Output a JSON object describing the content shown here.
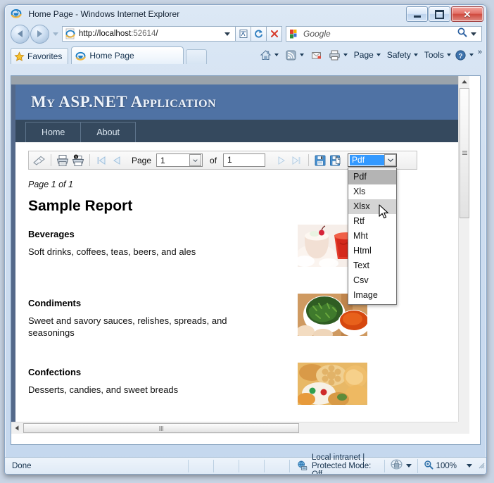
{
  "window": {
    "title": "Home Page - Windows Internet Explorer",
    "icon": "internet-explorer-icon",
    "minimize_label": "Minimize",
    "maximize_label": "Maximize",
    "close_label": "Close"
  },
  "navigation": {
    "back_label": "Back",
    "forward_label": "Forward",
    "recent_pages_label": "Recent Pages"
  },
  "address": {
    "url_scheme": "http://",
    "url_host": "localhost",
    "url_port": ":52614",
    "url_path": "/",
    "full_url": "http://localhost:52614/",
    "compat_view_label": "Compatibility View",
    "refresh_label": "Refresh",
    "stop_label": "Stop"
  },
  "search": {
    "placeholder": "Google",
    "provider": "Google",
    "go_label": "Search"
  },
  "favorites": {
    "label": "Favorites"
  },
  "tabs": [
    {
      "label": "Home Page",
      "icon": "internet-explorer-icon",
      "active": true
    }
  ],
  "newtab": {
    "label": "New Tab"
  },
  "command_bar": {
    "items": [
      {
        "label": "",
        "icon": "home-icon",
        "has_dropdown": true
      },
      {
        "label": "",
        "icon": "feeds-icon",
        "has_dropdown": true
      },
      {
        "label": "",
        "icon": "read-mail-icon",
        "has_dropdown": false
      },
      {
        "label": "",
        "icon": "print-icon",
        "has_dropdown": true
      },
      {
        "label": "Page",
        "icon": "",
        "has_dropdown": true
      },
      {
        "label": "Safety",
        "icon": "",
        "has_dropdown": true
      },
      {
        "label": "Tools",
        "icon": "",
        "has_dropdown": true
      },
      {
        "label": "",
        "icon": "help-icon",
        "has_dropdown": true
      }
    ],
    "overflow_label": "»"
  },
  "aspnet": {
    "site_title": "My ASP.NET Application",
    "nav": [
      {
        "label": "Home"
      },
      {
        "label": "About"
      }
    ]
  },
  "report_toolbar": {
    "document_map_label": "Document Map",
    "print_label": "Print",
    "print_layout_label": "Print Layout",
    "first_page_label": "First Page",
    "prev_page_label": "Previous Page",
    "page_label": "Page",
    "page_value": "1",
    "of_label": "of",
    "total_pages_value": "1",
    "next_page_label": "Next Page",
    "last_page_label": "Last Page",
    "save_label": "Save",
    "save_as_label": "Save As",
    "export_selected": "Pdf",
    "export_options": [
      {
        "label": "Pdf",
        "state": "selected"
      },
      {
        "label": "Xls",
        "state": "normal"
      },
      {
        "label": "Xlsx",
        "state": "hover"
      },
      {
        "label": "Rtf",
        "state": "normal"
      },
      {
        "label": "Mht",
        "state": "normal"
      },
      {
        "label": "Html",
        "state": "normal"
      },
      {
        "label": "Text",
        "state": "normal"
      },
      {
        "label": "Csv",
        "state": "normal"
      },
      {
        "label": "Image",
        "state": "normal"
      }
    ]
  },
  "report": {
    "page_info": "Page 1 of 1",
    "title": "Sample Report",
    "categories": [
      {
        "name": "Beverages",
        "description": "Soft drinks, coffees, teas, beers, and ales",
        "image": "beverages-photo"
      },
      {
        "name": "Condiments",
        "description": "Sweet and savory sauces, relishes, spreads, and seasonings",
        "image": "condiments-photo"
      },
      {
        "name": "Confections",
        "description": "Desserts, candies, and sweet breads",
        "image": "confections-photo"
      }
    ]
  },
  "statusbar": {
    "status": "Done",
    "zone": "Local intranet | Protected Mode: Off",
    "zone_icon": "intranet-zone-icon",
    "privacy_icon": "privacy-report-icon",
    "zoom_level": "100%",
    "zoom_icon": "zoom-icon"
  },
  "colors": {
    "aspnet_header_bg": "#4f72a4",
    "aspnet_nav_bg": "#35495e",
    "selection_blue": "#3399ff",
    "window_frame": "#c8d4e4",
    "dropdown_selected": "#b4b4b4",
    "dropdown_hover": "#d4d4d4"
  }
}
